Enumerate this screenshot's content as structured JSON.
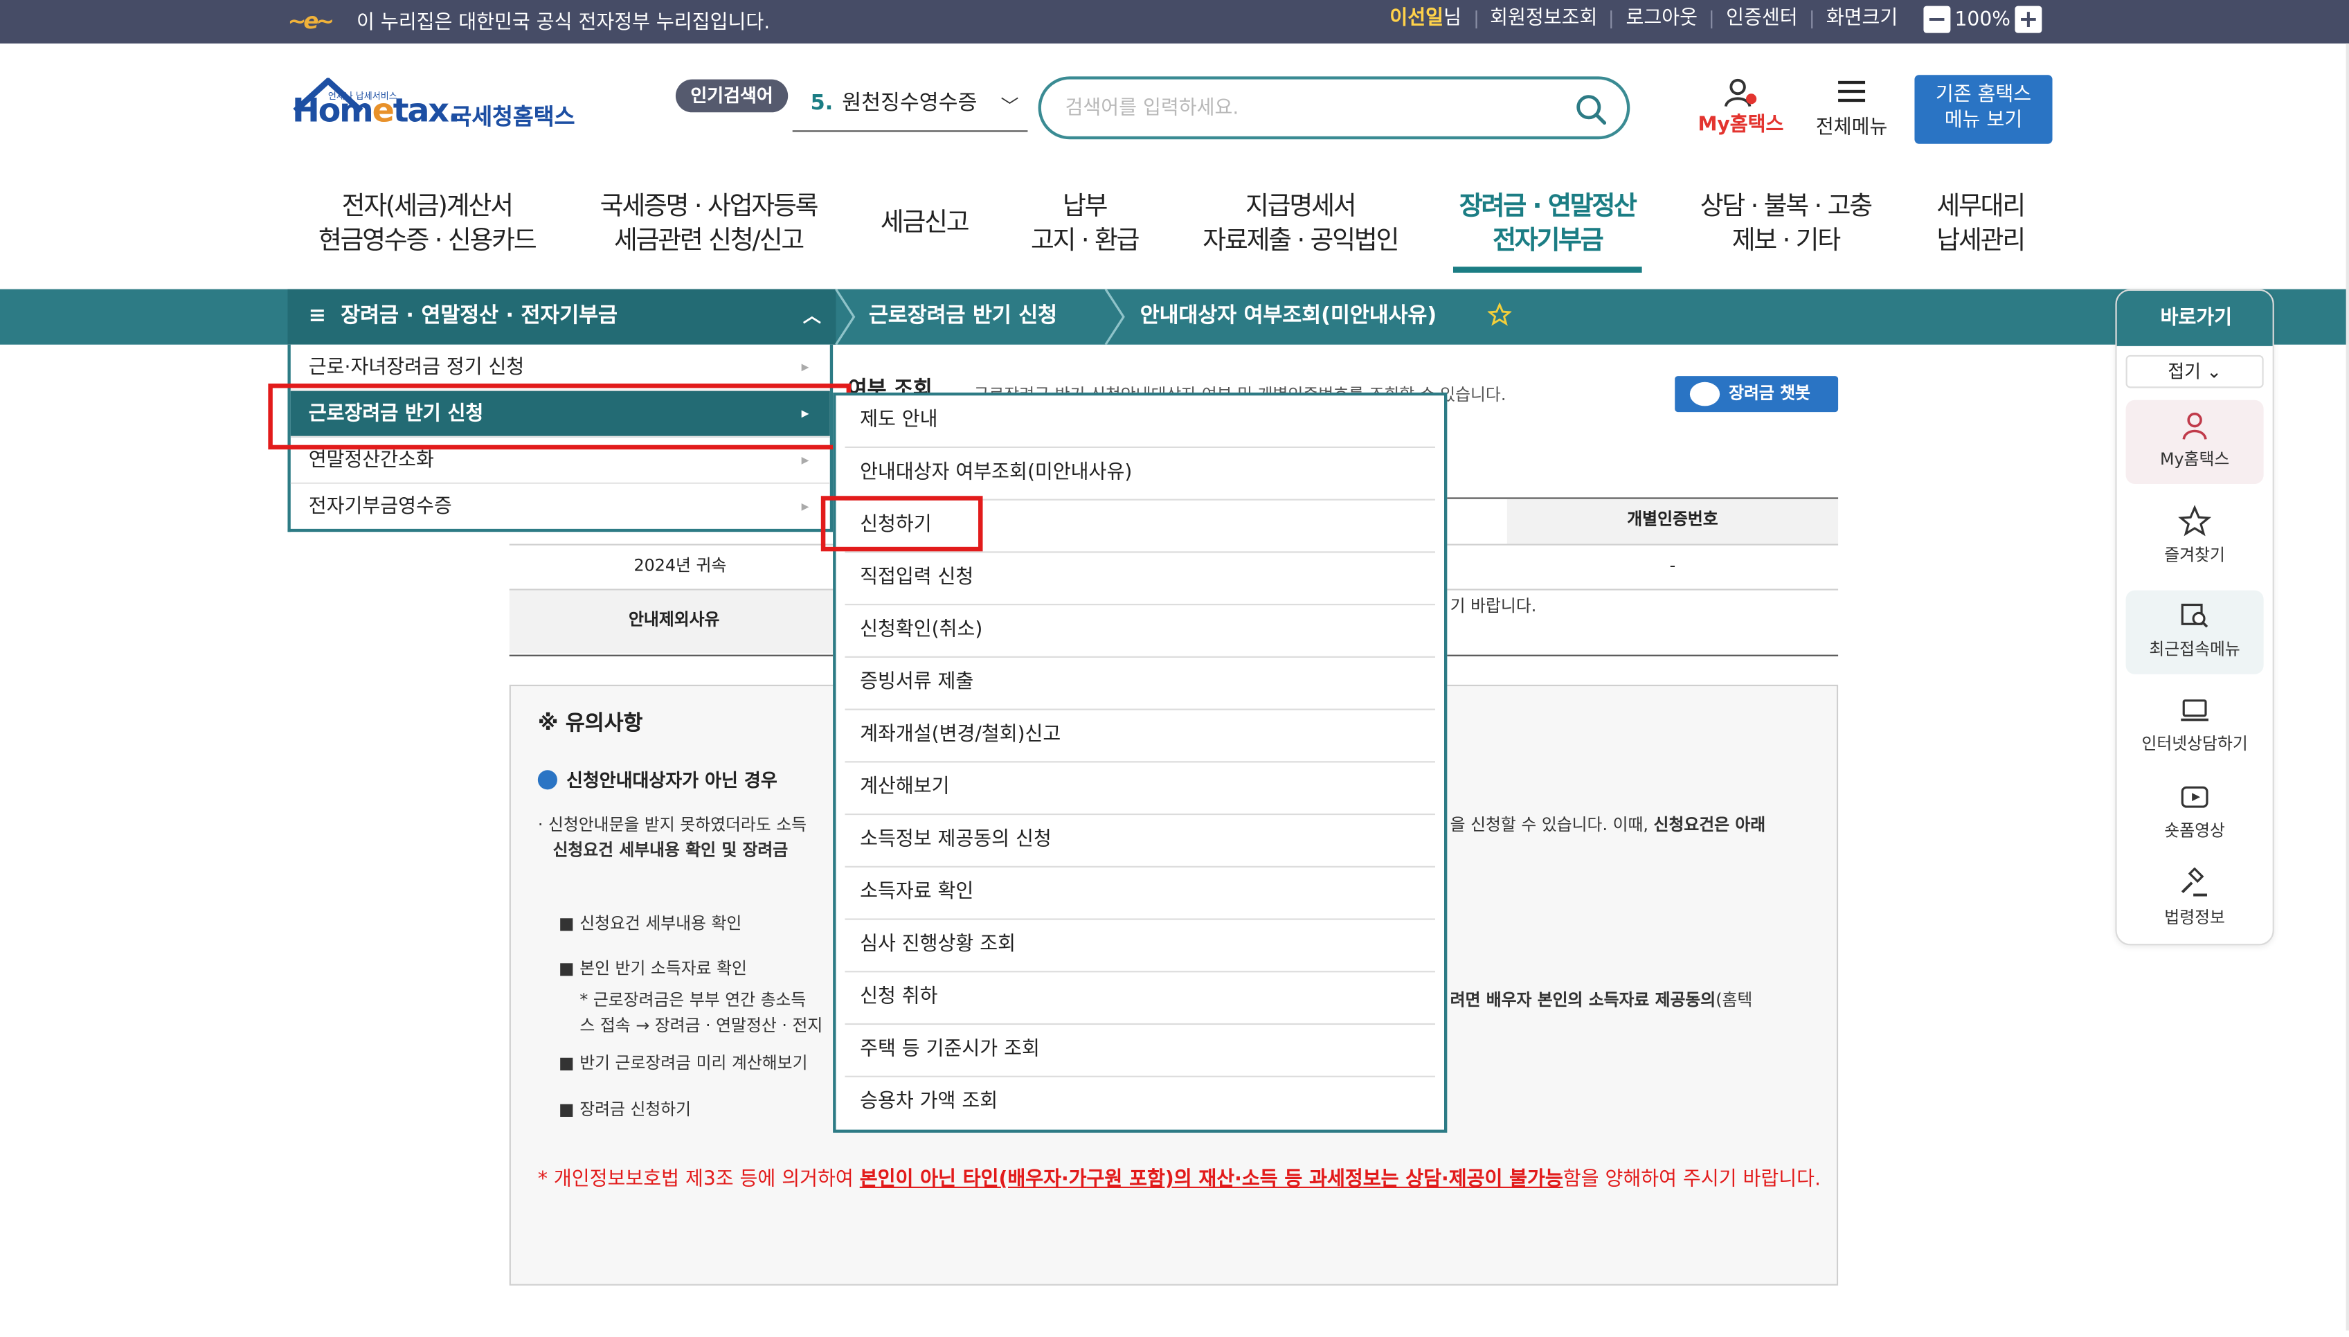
{
  "topbar": {
    "gov_notice": "이 누리집은 대한민국 공식 전자정부 누리집입니다.",
    "user_name": "이선일",
    "user_suffix": "님",
    "links": [
      "회원정보조회",
      "로그아웃",
      "인증센터",
      "화면크기"
    ],
    "zoom_value": "100%"
  },
  "header": {
    "logo_sub": "언제나 납세서비스",
    "logo_text_a": "Hom",
    "logo_text_b": "e",
    "logo_text_c": "tax.",
    "logo_name": "국세청홈택스",
    "popular_badge": "인기검색어",
    "popular_rank": "5.",
    "popular_term": "원천징수영수증",
    "search_placeholder": "검색어를 입력하세요.",
    "my_hometax": "My홈택스",
    "all_menu": "전체메뉴",
    "old_menu_line1": "기존 홈택스",
    "old_menu_line2": "메뉴 보기"
  },
  "gnb": [
    {
      "l1": "전자(세금)계산서",
      "l2": "현금영수증 · 신용카드"
    },
    {
      "l1": "국세증명 · 사업자등록",
      "l2": "세금관련 신청/신고"
    },
    {
      "l1": "세금신고",
      "l2": ""
    },
    {
      "l1": "납부",
      "l2": "고지 · 환급"
    },
    {
      "l1": "지급명세서",
      "l2": "자료제출 · 공익법인"
    },
    {
      "l1": "장려금 · 연말정산",
      "l2": "전자기부금"
    },
    {
      "l1": "상담 · 불복 · 고충",
      "l2": "제보 · 기타"
    },
    {
      "l1": "세무대리",
      "l2": "납세관리"
    }
  ],
  "lnb": {
    "menu_title": "장려금 · 연말정산 · 전자기부금",
    "crumb1": "근로장려금 반기 신청",
    "crumb2": "안내대상자 여부조회(미안내사유)"
  },
  "side_menu": [
    "근로·자녀장려금 정기 신청",
    "근로장려금 반기 신청",
    "연말정산간소화",
    "전자기부금영수증"
  ],
  "sub_menu": [
    "제도 안내",
    "안내대상자 여부조회(미안내사유)",
    "신청하기",
    "직접입력 신청",
    "신청확인(취소)",
    "증빙서류 제출",
    "계좌개설(변경/철회)신고",
    "계산해보기",
    "소득정보 제공동의 신청",
    "소득자료 확인",
    "심사 진행상황 조회",
    "신청 취하",
    "주택 등 기준시가 조회",
    "승용차 가액 조회"
  ],
  "content": {
    "title_fragment": "여부 조회",
    "desc": "근로장려금 반기 신청안내대상자 여부 및 개별인증번호를 조회할 수 있습니다.",
    "chatbot": "장려금 챗봇",
    "col_auth": "개별인증번호",
    "row_year": "2024년 귀속",
    "row_auth": "-",
    "row_reason_label": "안내제외사유",
    "row_reason_tail": "기 바랍니다."
  },
  "notice": {
    "title": "※ 유의사항",
    "sub": "신청안내대상자가 아닌 경우",
    "p1_a": "· 신청안내문을 받지 못하였더라도 소득",
    "p1_b": "을 신청할 수 있습니다. 이때,",
    "p1_bold": "신청요건은 아래",
    "p1_line2": "신청요건 세부내용 확인 및 장려금",
    "bullet1": "■ 신청요건 세부내용 확인",
    "bullet2": "■ 본인 반기 소득자료 확인",
    "bullet2_note_a": "* 근로장려금은 부부 연간 총소득",
    "bullet2_note_b": "려면 배우자 본인의 소득자료 제공동의",
    "bullet2_note_c": "(홈텍",
    "bullet2_note_line2": "스 접속 → 장려금 · 연말정산 · 전지",
    "bullet3": "■ 반기 근로장려금 미리 계산해보기",
    "bullet4": "■ 장려금 신청하기",
    "warn_a": "* 개인정보보호법 제3조 등에 의거하여 ",
    "warn_bold": "본인이 아닌 타인(배우자·가구원 포함)의 재산·소득 등 과세정보는 상담·제공이 불가능",
    "warn_b": "함을 양해하여 주시기 바랍니다."
  },
  "quick": {
    "title": "바로가기",
    "fold": "접기",
    "items": [
      "My홈택스",
      "즐겨찾기",
      "최근접속메뉴",
      "인터넷상담하기",
      "숏폼영상",
      "법령정보"
    ]
  },
  "colors": {
    "topbar": "#464c66",
    "teal": "#2d7b85",
    "teal_dark": "#236b74",
    "blue": "#2a74c4",
    "red": "#e21b1b"
  }
}
